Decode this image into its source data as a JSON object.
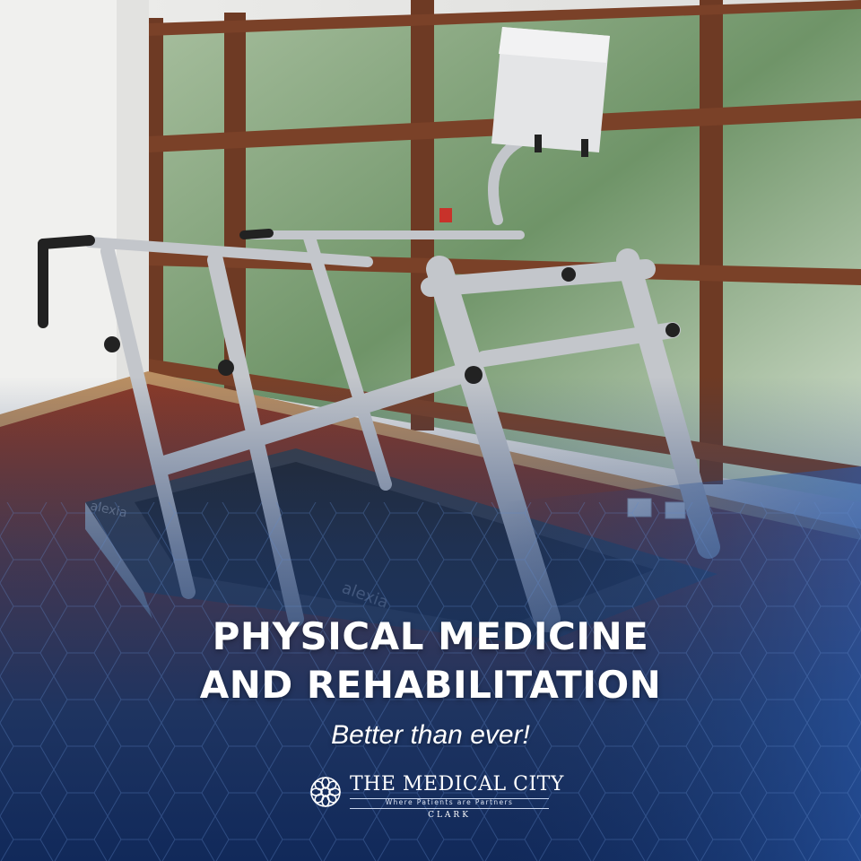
{
  "headline": {
    "line1": "PHYSICAL MEDICINE",
    "line2": "AND REHABILITATION"
  },
  "tagline": "Better than ever!",
  "brand": {
    "name": "THE MEDICAL CITY",
    "tagline": "Where Patients are Partners",
    "location": "CLARK",
    "icon": "flower-emblem-icon"
  },
  "equipment_label": "alexia",
  "colors": {
    "overlay_blue": "#1b3a72",
    "floor": "#7a3424",
    "window_frame": "#6e3a24",
    "foliage": "#7fa07a",
    "machine_silver": "#c3c6cb",
    "text": "#ffffff"
  }
}
